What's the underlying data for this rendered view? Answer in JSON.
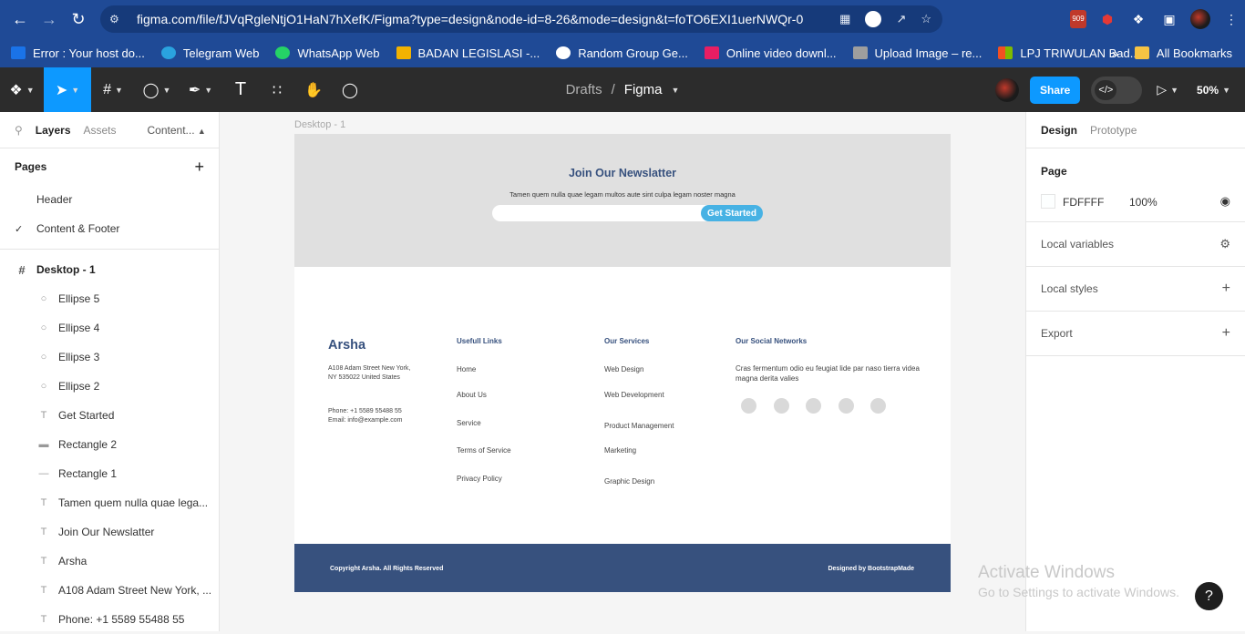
{
  "browser": {
    "url": "figma.com/file/fJVqRgleNtjO1HaN7hXefK/Figma?type=design&node-id=8-26&mode=design&t=foTO6EXI1uerNWQr-0",
    "ext_badge": "909"
  },
  "bookmarks": {
    "items": [
      {
        "label": "Error : Your host do...",
        "color": "#1a73e8"
      },
      {
        "label": "Telegram Web",
        "color": "#2aa3df"
      },
      {
        "label": "WhatsApp Web",
        "color": "#25d366"
      },
      {
        "label": "BADAN LEGISLASI -...",
        "color": "#f2b200"
      },
      {
        "label": "Random Group Ge...",
        "color": "#ffffff"
      },
      {
        "label": "Online video downl...",
        "color": "#e91e63"
      },
      {
        "label": "Upload Image – re...",
        "color": "#9e9e9e"
      },
      {
        "label": "LPJ TRIWULAN Bad...",
        "color": "#f25022"
      }
    ],
    "more": "»",
    "all": "All Bookmarks"
  },
  "figma": {
    "breadcrumb_parent": "Drafts",
    "breadcrumb_sep": "/",
    "file_name": "Figma",
    "share_label": "Share",
    "zoom": "50%",
    "accent": "#0d99ff"
  },
  "left_panel": {
    "tabs": [
      "Layers",
      "Assets",
      "Content..."
    ],
    "pages_title": "Pages",
    "pages": [
      "Header",
      "Content & Footer"
    ],
    "current_page": "Content & Footer",
    "frame_name": "Desktop - 1",
    "layers": [
      {
        "name": "Ellipse 5",
        "icon": "ellipse-icon"
      },
      {
        "name": "Ellipse 4",
        "icon": "ellipse-icon"
      },
      {
        "name": "Ellipse 3",
        "icon": "ellipse-icon"
      },
      {
        "name": "Ellipse 2",
        "icon": "ellipse-icon"
      },
      {
        "name": "Get Started",
        "icon": "text-icon"
      },
      {
        "name": "Rectangle 2",
        "icon": "rounded-rect-icon"
      },
      {
        "name": "Rectangle 1",
        "icon": "line-rect-icon"
      },
      {
        "name": "Tamen quem nulla quae lega...",
        "icon": "text-icon"
      },
      {
        "name": "Join Our Newslatter",
        "icon": "text-icon"
      },
      {
        "name": "Arsha",
        "icon": "text-icon"
      },
      {
        "name": "A108 Adam Street New York, ...",
        "icon": "text-icon"
      },
      {
        "name": "Phone: +1 5589 55488 55",
        "icon": "text-icon"
      }
    ]
  },
  "canvas": {
    "frame_label": "Desktop - 1",
    "newsletter": {
      "title": "Join Our Newslatter",
      "text": "Tamen quem nulla quae legam multos aute sint culpa legam noster magna",
      "button": "Get Started"
    },
    "footer": {
      "logo": "Arsha",
      "address": "A108 Adam Street New York, NY 535022 United States",
      "phone": "Phone: +1 5589 55488 55",
      "email": "Email:  info@example.com",
      "useful_title": "Usefull Links",
      "useful_links": [
        "Home",
        "About Us",
        "Service",
        "Terms of Service",
        "Privacy Policy"
      ],
      "services_title": "Our Services",
      "services": [
        "Web Design",
        "Web Development",
        "Product Management",
        "Marketing",
        "Graphic Design"
      ],
      "social_title": "Our Social Networks",
      "social_text": "Cras fermentum odio eu feugiat lide par naso tierra videa magna derita valies",
      "copyright": "Copyright Arsha. All Rights Reserved",
      "designed_by": "Designed by BootstrapMade"
    }
  },
  "right_panel": {
    "tabs": [
      "Design",
      "Prototype"
    ],
    "page_title": "Page",
    "page_color": "FDFFFF",
    "page_opacity": "100%",
    "sections": [
      "Local variables",
      "Local styles",
      "Export"
    ]
  },
  "watermark": {
    "line1": "Activate Windows",
    "line2": "Go to Settings to activate Windows."
  },
  "help_label": "?"
}
